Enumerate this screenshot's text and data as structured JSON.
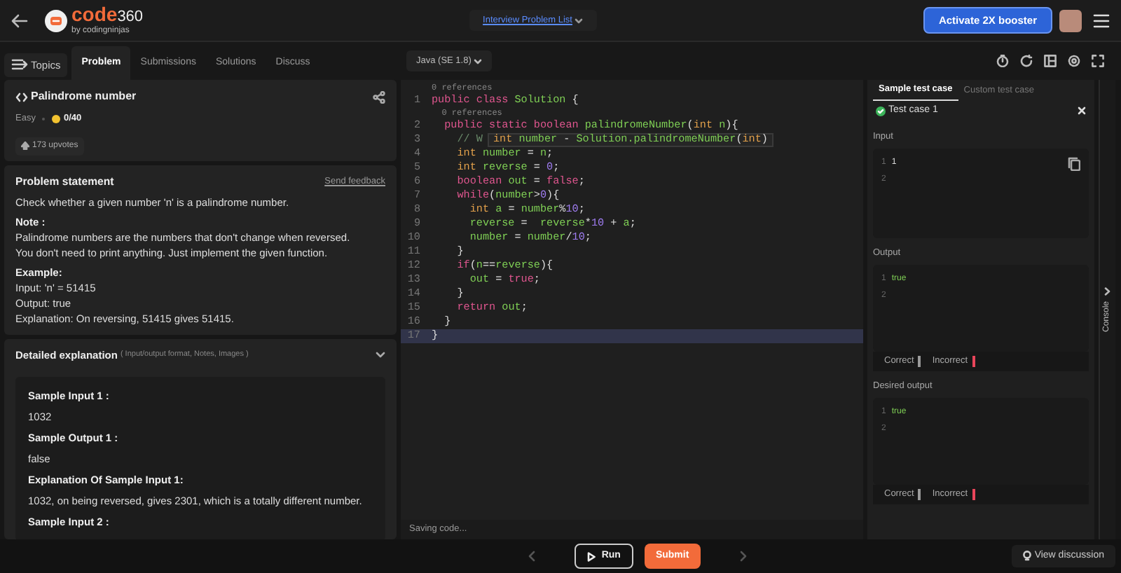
{
  "header": {
    "logo": {
      "name": "code",
      "suffix": "360",
      "tagline": "by codingninjas"
    },
    "problem_list": "Interview Problem List",
    "booster_button": "Activate 2X booster"
  },
  "tabs": [
    {
      "label": "Problem",
      "selected": true
    },
    {
      "label": "Submissions",
      "selected": false
    },
    {
      "label": "Solutions",
      "selected": false
    },
    {
      "label": "Discuss",
      "selected": false
    }
  ],
  "topics_button": "Topics",
  "problem": {
    "title": "Palindrome number",
    "difficulty": "Easy",
    "score": "0/40",
    "upvotes": "173 upvotes",
    "statement_title": "Problem statement",
    "feedback_link": "Send feedback",
    "blocks": [
      {
        "kind": "text",
        "text": "Check whether a given number 'n' is a palindrome number."
      },
      {
        "kind": "heading",
        "text": "Note :"
      },
      {
        "kind": "text",
        "text": "Palindrome numbers are the numbers that don't change when reversed."
      },
      {
        "kind": "text",
        "text": "You don't need to print anything. Just implement the given function."
      },
      {
        "kind": "heading",
        "text": "Example:"
      },
      {
        "kind": "text",
        "text": "Input: 'n' = 51415"
      },
      {
        "kind": "text",
        "text": "Output: true"
      },
      {
        "kind": "text",
        "text": "Explanation: On reversing, 51415 gives 51415."
      }
    ],
    "details": {
      "title": "Detailed explanation",
      "hint": "( Input/output format, Notes, Images )",
      "expanded": true,
      "blocks": [
        {
          "kind": "heading",
          "text": "Sample Input 1 :"
        },
        {
          "kind": "text",
          "text": "1032"
        },
        {
          "kind": "heading",
          "text": "Sample Output 1 :"
        },
        {
          "kind": "text",
          "text": "false"
        },
        {
          "kind": "heading",
          "text": "Explanation Of Sample Input 1:"
        },
        {
          "kind": "text",
          "text": "1032, on being reversed, gives 2301, which is a totally different number."
        },
        {
          "kind": "heading",
          "text": "Sample Input 2 :"
        }
      ]
    }
  },
  "editor": {
    "language": "Java (SE 1.8)",
    "status": "Saving code...",
    "lines": [
      {
        "kind": "reference",
        "text": "0 references"
      },
      {
        "kind": "code",
        "number": "1",
        "active": false,
        "tokens": [
          {
            "kind": "keyword",
            "text": "public class "
          },
          {
            "kind": "name",
            "text": "Solution"
          },
          {
            "kind": "plain",
            "text": " {"
          }
        ]
      },
      {
        "kind": "reference",
        "text": "  0 references"
      },
      {
        "kind": "code",
        "number": "2",
        "active": false,
        "tokens": [
          {
            "kind": "keyword",
            "text": "  public static boolean "
          },
          {
            "kind": "name",
            "text": "palindromeNumber"
          },
          {
            "kind": "plain",
            "text": "("
          },
          {
            "kind": "type",
            "text": "int "
          },
          {
            "kind": "name",
            "text": "n"
          },
          {
            "kind": "plain",
            "text": "){"
          }
        ]
      },
      {
        "kind": "code",
        "number": "3",
        "active": false,
        "tokens": [
          {
            "kind": "comment",
            "text": "    // W"
          }
        ],
        "tooltip": [
          {
            "kind": "type",
            "text": "int "
          },
          {
            "kind": "name",
            "text": "number"
          },
          {
            "kind": "plain",
            "text": " - "
          },
          {
            "kind": "name",
            "text": "Solution.palindromeNumber"
          },
          {
            "kind": "plain",
            "text": "("
          },
          {
            "kind": "type",
            "text": "int"
          },
          {
            "kind": "plain",
            "text": ")"
          }
        ]
      },
      {
        "kind": "code",
        "number": "4",
        "active": false,
        "tokens": [
          {
            "kind": "type",
            "text": "    int "
          },
          {
            "kind": "name",
            "text": "number"
          },
          {
            "kind": "plain",
            "text": " = "
          },
          {
            "kind": "name",
            "text": "n"
          },
          {
            "kind": "plain",
            "text": ";"
          }
        ]
      },
      {
        "kind": "code",
        "number": "5",
        "active": false,
        "tokens": [
          {
            "kind": "type",
            "text": "    int "
          },
          {
            "kind": "name",
            "text": "reverse"
          },
          {
            "kind": "plain",
            "text": " = "
          },
          {
            "kind": "number",
            "text": "0"
          },
          {
            "kind": "plain",
            "text": ";"
          }
        ]
      },
      {
        "kind": "code",
        "number": "6",
        "active": false,
        "tokens": [
          {
            "kind": "keyword",
            "text": "    boolean "
          },
          {
            "kind": "name",
            "text": "out"
          },
          {
            "kind": "plain",
            "text": " = "
          },
          {
            "kind": "keyword",
            "text": "false"
          },
          {
            "kind": "plain",
            "text": ";"
          }
        ]
      },
      {
        "kind": "code",
        "number": "7",
        "active": false,
        "tokens": [
          {
            "kind": "keyword",
            "text": "    while"
          },
          {
            "kind": "plain",
            "text": "("
          },
          {
            "kind": "name",
            "text": "number"
          },
          {
            "kind": "plain",
            "text": ">"
          },
          {
            "kind": "number",
            "text": "0"
          },
          {
            "kind": "plain",
            "text": "){"
          }
        ]
      },
      {
        "kind": "code",
        "number": "8",
        "active": false,
        "tokens": [
          {
            "kind": "type",
            "text": "      int "
          },
          {
            "kind": "name",
            "text": "a"
          },
          {
            "kind": "plain",
            "text": " = "
          },
          {
            "kind": "name",
            "text": "number"
          },
          {
            "kind": "plain",
            "text": "%"
          },
          {
            "kind": "number",
            "text": "10"
          },
          {
            "kind": "plain",
            "text": ";"
          }
        ]
      },
      {
        "kind": "code",
        "number": "9",
        "active": false,
        "tokens": [
          {
            "kind": "name",
            "text": "      reverse"
          },
          {
            "kind": "plain",
            "text": " =  "
          },
          {
            "kind": "name",
            "text": "reverse"
          },
          {
            "kind": "plain",
            "text": "*"
          },
          {
            "kind": "number",
            "text": "10"
          },
          {
            "kind": "plain",
            "text": " + "
          },
          {
            "kind": "name",
            "text": "a"
          },
          {
            "kind": "plain",
            "text": ";"
          }
        ]
      },
      {
        "kind": "code",
        "number": "10",
        "active": false,
        "tokens": [
          {
            "kind": "name",
            "text": "      number"
          },
          {
            "kind": "plain",
            "text": " = "
          },
          {
            "kind": "name",
            "text": "number"
          },
          {
            "kind": "plain",
            "text": "/"
          },
          {
            "kind": "number",
            "text": "10"
          },
          {
            "kind": "plain",
            "text": ";"
          }
        ]
      },
      {
        "kind": "code",
        "number": "11",
        "active": false,
        "tokens": [
          {
            "kind": "plain",
            "text": "    }"
          }
        ]
      },
      {
        "kind": "code",
        "number": "12",
        "active": false,
        "tokens": [
          {
            "kind": "keyword",
            "text": "    if"
          },
          {
            "kind": "plain",
            "text": "("
          },
          {
            "kind": "name",
            "text": "n"
          },
          {
            "kind": "plain",
            "text": "=="
          },
          {
            "kind": "name",
            "text": "reverse"
          },
          {
            "kind": "plain",
            "text": "){"
          }
        ]
      },
      {
        "kind": "code",
        "number": "13",
        "active": false,
        "tokens": [
          {
            "kind": "name",
            "text": "      out"
          },
          {
            "kind": "plain",
            "text": " = "
          },
          {
            "kind": "keyword",
            "text": "true"
          },
          {
            "kind": "plain",
            "text": ";"
          }
        ]
      },
      {
        "kind": "code",
        "number": "14",
        "active": false,
        "tokens": [
          {
            "kind": "plain",
            "text": "    }"
          }
        ]
      },
      {
        "kind": "code",
        "number": "15",
        "active": false,
        "tokens": [
          {
            "kind": "keyword",
            "text": "    return "
          },
          {
            "kind": "name",
            "text": "out"
          },
          {
            "kind": "plain",
            "text": ";"
          }
        ]
      },
      {
        "kind": "code",
        "number": "16",
        "active": false,
        "tokens": [
          {
            "kind": "plain",
            "text": "  }"
          }
        ]
      },
      {
        "kind": "code",
        "number": "17",
        "active": true,
        "tokens": [
          {
            "kind": "plain",
            "text": "}"
          }
        ]
      }
    ]
  },
  "testcases": {
    "tabs": [
      {
        "label": "Sample test case",
        "selected": true
      },
      {
        "label": "Custom test case",
        "selected": false
      }
    ],
    "case": {
      "label": "Test case 1",
      "passed": true
    },
    "sections": [
      {
        "label": "Input",
        "lines": [
          {
            "number": "1",
            "text": "1"
          },
          {
            "number": "2"
          }
        ],
        "copyable": true
      },
      {
        "label": "Output",
        "lines": [
          {
            "number": "1",
            "text": "true"
          },
          {
            "number": "2"
          }
        ],
        "copyable": false,
        "legend": [
          {
            "label": "Correct",
            "color": "#9a9a9a"
          },
          {
            "label": "Incorrect",
            "color": "#e8455a"
          }
        ]
      },
      {
        "label": "Desired output",
        "lines": [
          {
            "number": "1",
            "text": "true"
          },
          {
            "number": "2"
          }
        ],
        "copyable": false,
        "legend": [
          {
            "label": "Correct",
            "color": "#9a9a9a"
          },
          {
            "label": "Incorrect",
            "color": "#e8455a"
          }
        ]
      }
    ]
  },
  "console_tab": "Console",
  "footer": {
    "run": "Run",
    "submit": "Submit",
    "discussion": "View discussion"
  }
}
